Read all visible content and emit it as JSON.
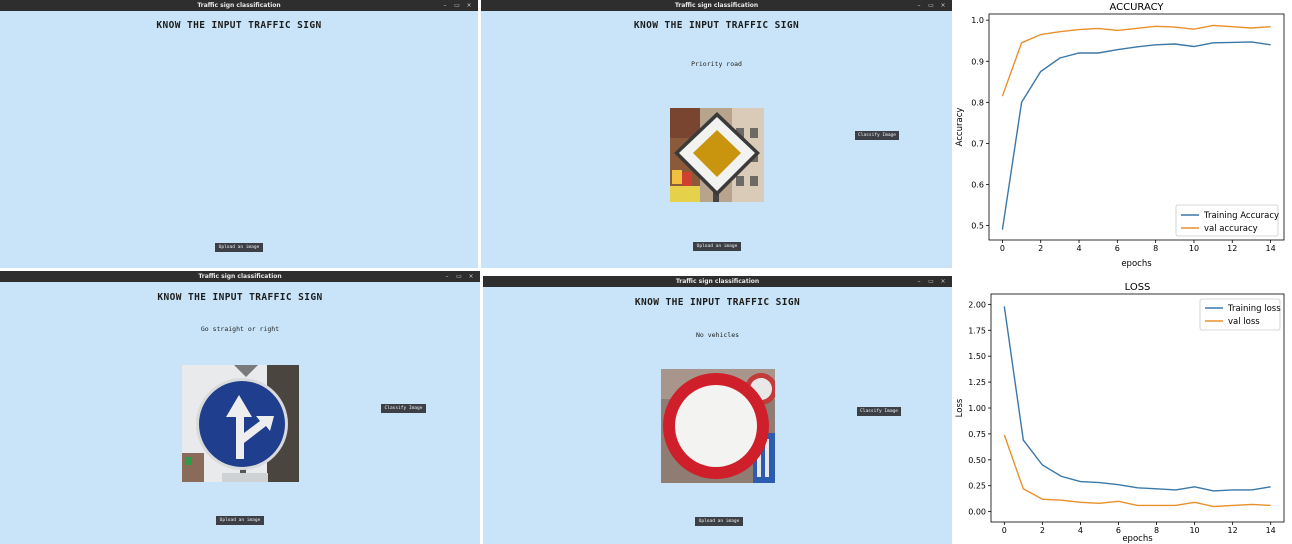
{
  "app": {
    "window_title": "Traffic sign classification",
    "heading": "KNOW THE INPUT TRAFFIC SIGN",
    "upload_label": "Upload an image",
    "classify_label": "Classify Image",
    "window_buttons": [
      "–",
      "▭",
      "×"
    ]
  },
  "windows": [
    {
      "result": ""
    },
    {
      "result": "Priority road"
    },
    {
      "result": "Go straight or right"
    },
    {
      "result": "No vehicles"
    }
  ],
  "colors": {
    "training": "#3a78a8",
    "val": "#e8902a"
  },
  "chart_data": [
    {
      "type": "line",
      "title": "ACCURACY",
      "xlabel": "epochs",
      "ylabel": "Accuracy",
      "x": [
        0,
        1,
        2,
        3,
        4,
        5,
        6,
        7,
        8,
        9,
        10,
        11,
        12,
        13,
        14
      ],
      "xticks": [
        0,
        2,
        4,
        6,
        8,
        10,
        12,
        14
      ],
      "yticks": [
        0.5,
        0.6,
        0.7,
        0.8,
        0.9,
        1.0
      ],
      "ytick_labels": [
        "0.5",
        "0.6",
        "0.7",
        "0.8",
        "0.9",
        "1.0"
      ],
      "xlim": [
        -0.7,
        14.7
      ],
      "ylim": [
        0.465,
        1.015
      ],
      "legend": "lower right",
      "series": [
        {
          "name": "Training Accuracy",
          "values": [
            0.49,
            0.8,
            0.875,
            0.908,
            0.92,
            0.92,
            0.928,
            0.935,
            0.94,
            0.942,
            0.936,
            0.945,
            0.946,
            0.947,
            0.94
          ]
        },
        {
          "name": "val accuracy",
          "values": [
            0.815,
            0.945,
            0.965,
            0.972,
            0.977,
            0.98,
            0.975,
            0.98,
            0.985,
            0.983,
            0.978,
            0.987,
            0.984,
            0.981,
            0.984
          ]
        }
      ]
    },
    {
      "type": "line",
      "title": "LOSS",
      "xlabel": "epochs",
      "ylabel": "Loss",
      "x": [
        0,
        1,
        2,
        3,
        4,
        5,
        6,
        7,
        8,
        9,
        10,
        11,
        12,
        13,
        14
      ],
      "xticks": [
        0,
        2,
        4,
        6,
        8,
        10,
        12,
        14
      ],
      "yticks": [
        0,
        0.25,
        0.5,
        0.75,
        1.0,
        1.25,
        1.5,
        1.75,
        2.0
      ],
      "ytick_labels": [
        "0.00",
        "0.25",
        "0.50",
        "0.75",
        "1.00",
        "1.25",
        "1.50",
        "1.75",
        "2.00"
      ],
      "xlim": [
        -0.7,
        14.7
      ],
      "ylim": [
        -0.1,
        2.1
      ],
      "legend": "upper right",
      "series": [
        {
          "name": "Training loss",
          "values": [
            1.98,
            0.69,
            0.45,
            0.34,
            0.29,
            0.28,
            0.26,
            0.23,
            0.22,
            0.21,
            0.24,
            0.2,
            0.21,
            0.21,
            0.24
          ]
        },
        {
          "name": "val loss",
          "values": [
            0.74,
            0.22,
            0.12,
            0.11,
            0.09,
            0.08,
            0.1,
            0.06,
            0.06,
            0.06,
            0.09,
            0.05,
            0.06,
            0.07,
            0.06
          ]
        }
      ]
    }
  ]
}
